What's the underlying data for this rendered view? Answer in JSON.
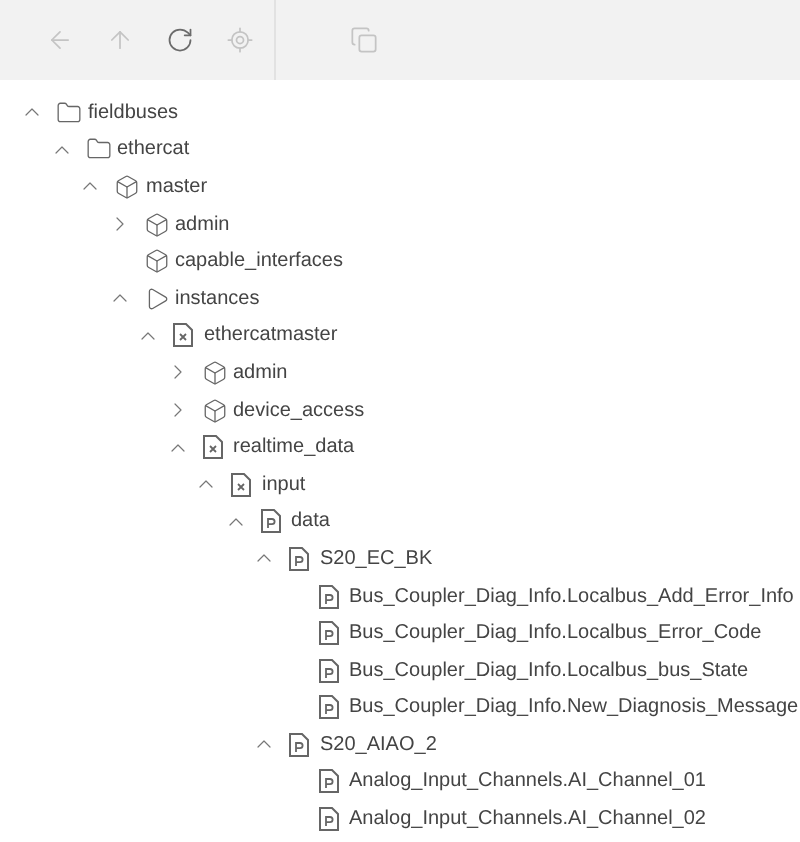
{
  "toolbar": {
    "navigation": [
      {
        "kind": "back",
        "disabled": true
      },
      {
        "kind": "up",
        "disabled": true
      },
      {
        "kind": "refresh",
        "disabled": false
      },
      {
        "kind": "locate",
        "disabled": true
      }
    ],
    "actions": [
      {
        "kind": "copy",
        "disabled": true
      }
    ]
  },
  "tree": [
    {
      "label": "fieldbuses",
      "kind": "folder",
      "expanded": true,
      "children": [
        {
          "label": "ethercat",
          "kind": "folder",
          "expanded": true,
          "children": [
            {
              "label": "master",
              "kind": "cube",
              "expanded": true,
              "children": [
                {
                  "label": "admin",
                  "kind": "cube",
                  "expanded": false
                },
                {
                  "label": "capable_interfaces",
                  "kind": "cube"
                },
                {
                  "label": "instances",
                  "kind": "triangle",
                  "expanded": true,
                  "children": [
                    {
                      "label": "ethercatmaster",
                      "kind": "device",
                      "expanded": true,
                      "children": [
                        {
                          "label": "admin",
                          "kind": "cube",
                          "expanded": false
                        },
                        {
                          "label": "device_access",
                          "kind": "cube",
                          "expanded": false
                        },
                        {
                          "label": "realtime_data",
                          "kind": "device",
                          "expanded": true,
                          "children": [
                            {
                              "label": "input",
                              "kind": "device",
                              "expanded": true,
                              "children": [
                                {
                                  "label": "data",
                                  "kind": "data",
                                  "expanded": true,
                                  "children": [
                                    {
                                      "label": "S20_EC_BK",
                                      "kind": "data",
                                      "expanded": true,
                                      "children": [
                                        {
                                          "label": "Bus_Coupler_Diag_Info.Localbus_Add_Error_Info",
                                          "kind": "data"
                                        },
                                        {
                                          "label": "Bus_Coupler_Diag_Info.Localbus_Error_Code",
                                          "kind": "data"
                                        },
                                        {
                                          "label": "Bus_Coupler_Diag_Info.Localbus_bus_State",
                                          "kind": "data"
                                        },
                                        {
                                          "label": "Bus_Coupler_Diag_Info.New_Diagnosis_Message",
                                          "kind": "data"
                                        }
                                      ]
                                    },
                                    {
                                      "label": "S20_AIAO_2",
                                      "kind": "data",
                                      "expanded": true,
                                      "children": [
                                        {
                                          "label": "Analog_Input_Channels.AI_Channel_01",
                                          "kind": "data"
                                        },
                                        {
                                          "label": "Analog_Input_Channels.AI_Channel_02",
                                          "kind": "data"
                                        }
                                      ]
                                    }
                                  ]
                                }
                              ]
                            }
                          ]
                        }
                      ]
                    }
                  ]
                }
              ]
            }
          ]
        }
      ]
    }
  ]
}
